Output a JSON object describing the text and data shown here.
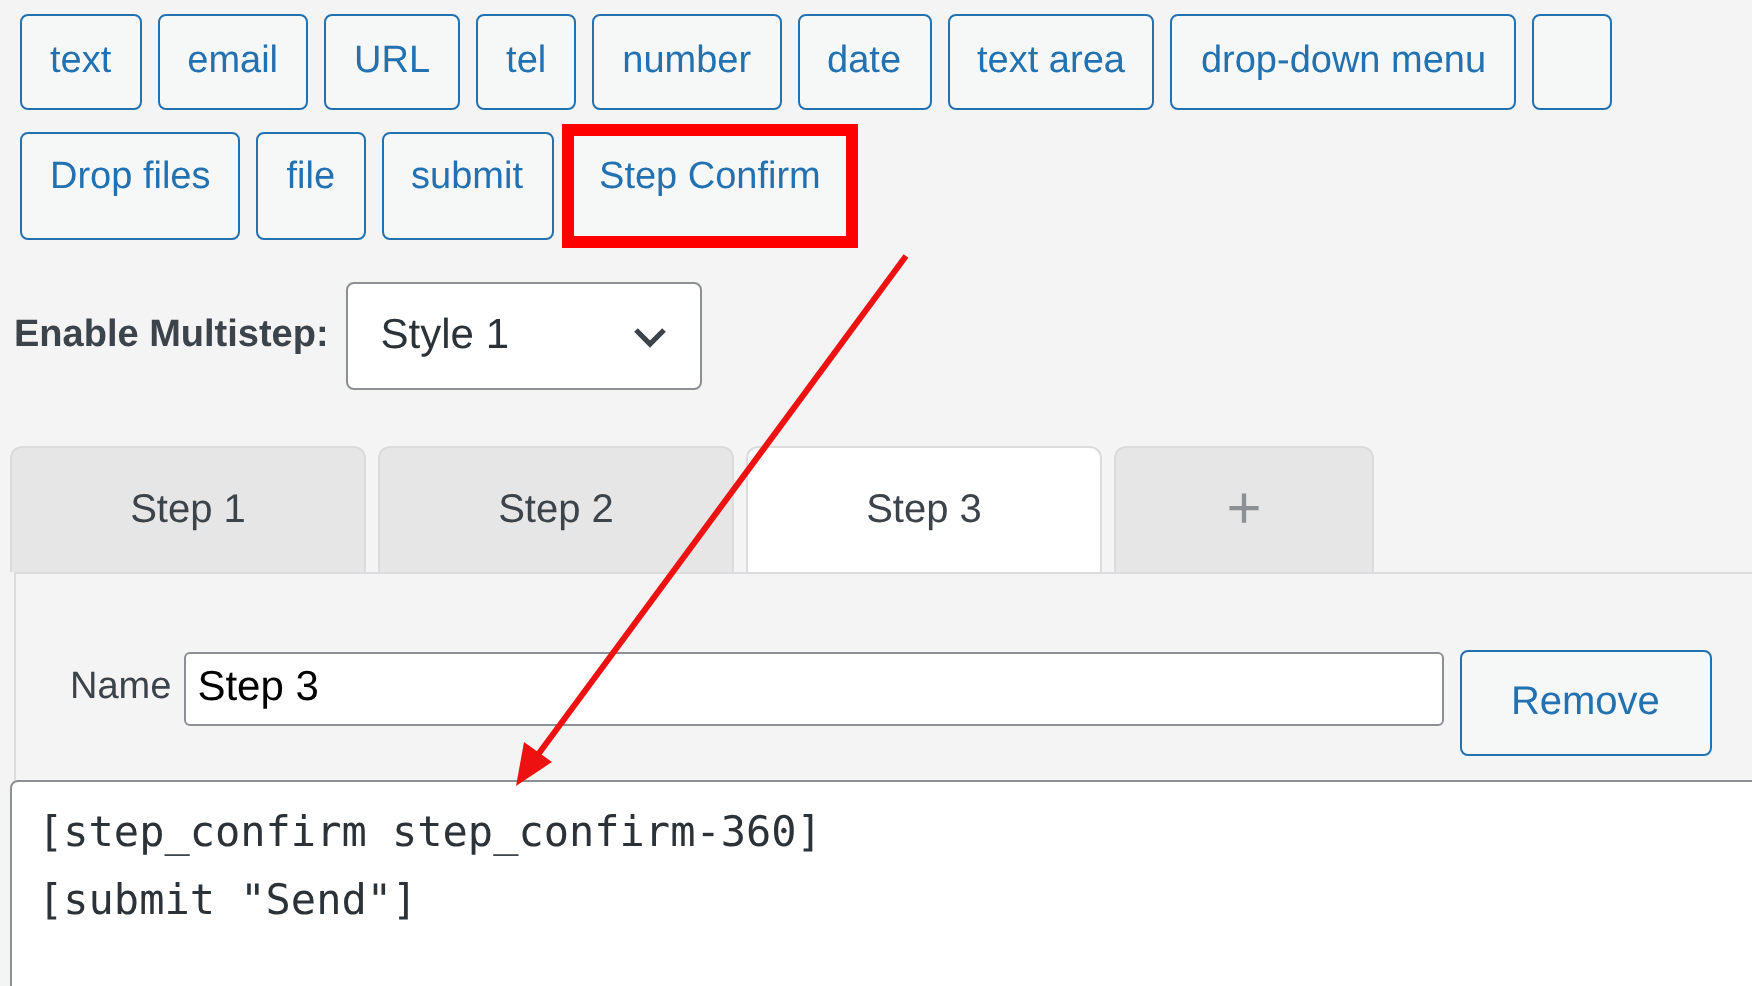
{
  "tag_button_rows": [
    {
      "buttons": [
        {
          "label": "text",
          "highlighted": false
        },
        {
          "label": "email",
          "highlighted": false
        },
        {
          "label": "URL",
          "highlighted": false
        },
        {
          "label": "tel",
          "highlighted": false
        },
        {
          "label": "number",
          "highlighted": false
        },
        {
          "label": "date",
          "highlighted": false
        },
        {
          "label": "text area",
          "highlighted": false
        },
        {
          "label": "drop-down menu",
          "highlighted": false
        }
      ]
    },
    {
      "buttons": [
        {
          "label": "Drop files",
          "highlighted": false
        },
        {
          "label": "file",
          "highlighted": false
        },
        {
          "label": "submit",
          "highlighted": false
        },
        {
          "label": "Step Confirm",
          "highlighted": true
        }
      ]
    }
  ],
  "multistep": {
    "label": "Enable Multistep:",
    "value": "Style 1"
  },
  "tabs": [
    {
      "kind": "step",
      "label": "Step 1",
      "selected": false
    },
    {
      "kind": "step",
      "label": "Step 2",
      "selected": false
    },
    {
      "kind": "step",
      "label": "Step 3",
      "selected": true
    },
    {
      "kind": "add",
      "label": "+",
      "selected": false
    }
  ],
  "step_name": {
    "label": "Name",
    "value": "Step 3"
  },
  "remove_button": "Remove",
  "form_code": [
    "[step_confirm step_confirm-360]",
    "[submit \"Send\"]"
  ]
}
